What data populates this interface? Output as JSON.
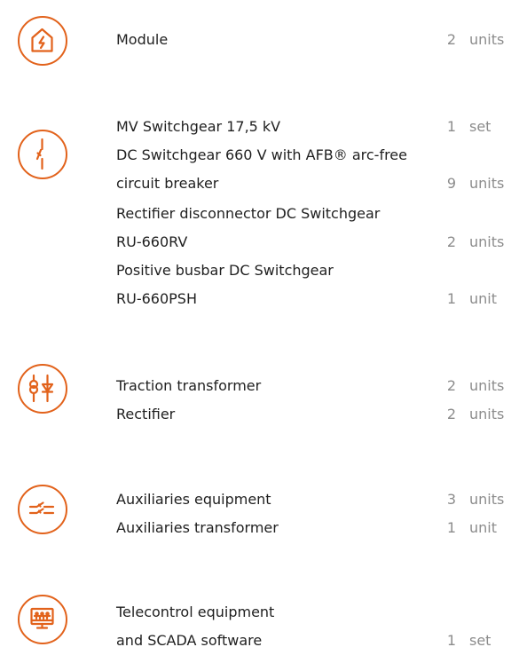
{
  "colors": {
    "accent": "#e2621b",
    "text": "#1f1f1f",
    "muted": "#8c8c8c"
  },
  "groups": [
    {
      "icon": "house-lightning-icon",
      "lines": [
        {
          "desc": "Module",
          "qty": "2",
          "unit": "units"
        }
      ]
    },
    {
      "icon": "disconnector-switch-icon",
      "lines": [
        {
          "desc": "MV Switchgear 17,5 kV",
          "qty": "1",
          "unit": "set"
        },
        {
          "desc": "DC Switchgear 660 V with AFB® arc-free",
          "qty": "",
          "unit": ""
        },
        {
          "desc": "circuit breaker",
          "qty": "9",
          "unit": "units"
        },
        {
          "desc": "Rectifier disconnector DC Switchgear",
          "qty": "",
          "unit": ""
        },
        {
          "desc": "RU-660RV",
          "qty": "2",
          "unit": "units"
        },
        {
          "desc": "Positive busbar DC Switchgear",
          "qty": "",
          "unit": ""
        },
        {
          "desc": "RU-660PSH",
          "qty": "1",
          "unit": "unit"
        }
      ]
    },
    {
      "icon": "transformer-rectifier-icon",
      "lines": [
        {
          "desc": "Traction transformer",
          "qty": "2",
          "unit": "units"
        },
        {
          "desc": "Rectifier",
          "qty": "2",
          "unit": "units"
        }
      ]
    },
    {
      "icon": "auxiliary-switch-icon",
      "lines": [
        {
          "desc": "Auxiliaries equipment",
          "qty": "3",
          "unit": "units"
        },
        {
          "desc": "Auxiliaries transformer",
          "qty": "1",
          "unit": "unit"
        }
      ]
    },
    {
      "icon": "scada-monitor-icon",
      "lines": [
        {
          "desc": "Telecontrol equipment",
          "qty": "",
          "unit": ""
        },
        {
          "desc": "and SCADA software",
          "qty": "1",
          "unit": "set"
        }
      ]
    }
  ]
}
